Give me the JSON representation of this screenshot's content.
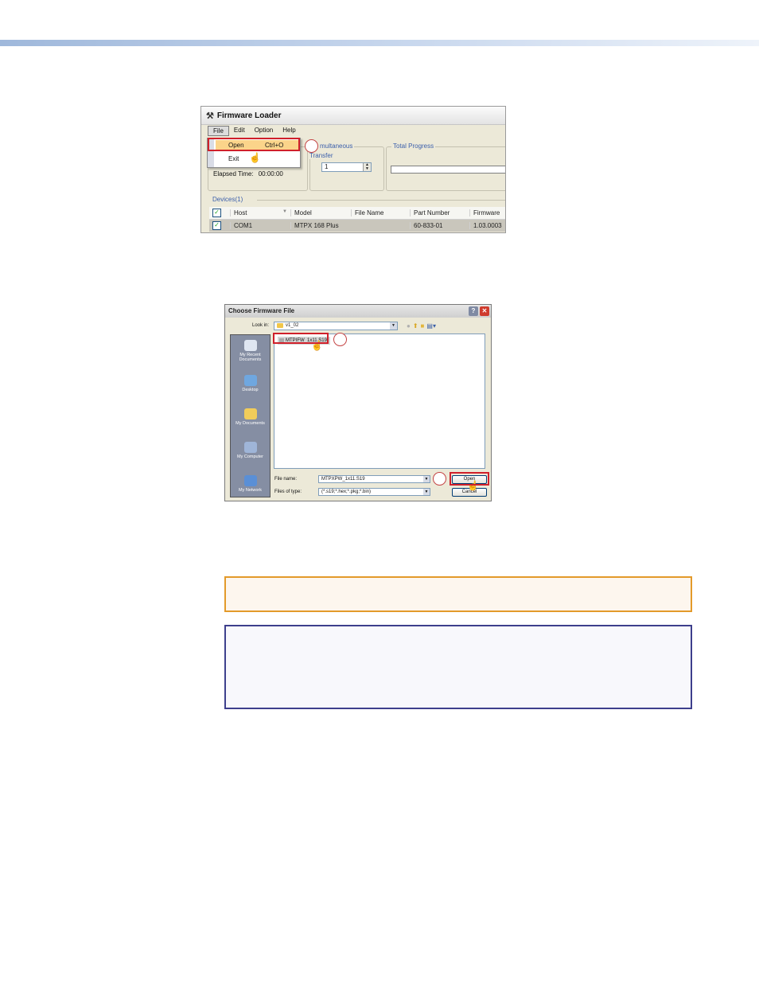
{
  "loader": {
    "title": "Firmware Loader",
    "menu": [
      "File",
      "Edit",
      "Option",
      "Help"
    ],
    "file_menu": {
      "open_label": "Open",
      "open_shortcut": "Ctrl+O",
      "exit_label": "Exit"
    },
    "simultaneous_label_1": "multaneous",
    "simultaneous_label_2": "Transfer",
    "simultaneous_value": "1",
    "total_progress_label": "Total Progress",
    "elapsed_label": "Elapsed Time:",
    "elapsed_value": "00:00:00",
    "devices_label": "Devices(1)",
    "columns": [
      "Host",
      "Model",
      "File Name",
      "Part Number",
      "Firmware"
    ],
    "rows": [
      {
        "host": "COM1",
        "model": "MTPX 168 Plus",
        "file_name": "",
        "part_number": "60-833-01",
        "firmware": "1.03.0003"
      }
    ]
  },
  "chooser": {
    "title": "Choose Firmware File",
    "look_in_label": "Look in:",
    "look_in_value": "v1_02",
    "places": [
      "My Recent Documents",
      "Desktop",
      "My Documents",
      "My Computer",
      "My Network"
    ],
    "files": [
      "MTPIFW_1x11.S19"
    ],
    "file_name_label": "File name:",
    "file_name_value": "MTPXPW_1x11.S19",
    "files_of_type_label": "Files of type:",
    "files_of_type_value": "(*.s19;*.hex;*.pkg;*.bin)",
    "open_button": "Open",
    "cancel_button": "Cancel"
  },
  "colors": {
    "highlight_red": "#d0202a",
    "caution_border": "#e39a2a",
    "note_border": "#3d3f8c"
  }
}
